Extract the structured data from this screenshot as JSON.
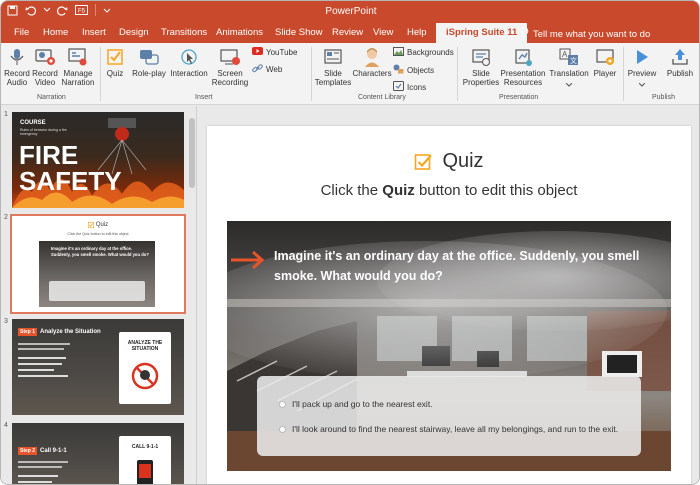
{
  "app": {
    "title": "PowerPoint"
  },
  "tabs": [
    {
      "label": "File"
    },
    {
      "label": "Home"
    },
    {
      "label": "Insert"
    },
    {
      "label": "Design"
    },
    {
      "label": "Transitions"
    },
    {
      "label": "Animations"
    },
    {
      "label": "Slide Show"
    },
    {
      "label": "Review"
    },
    {
      "label": "View"
    },
    {
      "label": "Help"
    },
    {
      "label": "iSpring Suite 11"
    }
  ],
  "tell_me": "Tell me what you want to do",
  "ribbon": {
    "narration": {
      "label": "Narration",
      "record_audio": "Record Audio",
      "record_video": "Record Video",
      "manage_narration": "Manage Narration"
    },
    "insert": {
      "label": "Insert",
      "quiz": "Quiz",
      "role_play": "Role-play",
      "interaction": "Interaction",
      "screen_recording": "Screen Recording",
      "youtube": "YouTube",
      "web": "Web"
    },
    "content_library": {
      "label": "Content Library",
      "slide_templates": "Slide Templates",
      "characters": "Characters",
      "backgrounds": "Backgrounds",
      "objects": "Objects",
      "icons": "Icons"
    },
    "presentation": {
      "label": "Presentation",
      "slide_properties": "Slide Properties",
      "presentation_resources": "Presentation Resources",
      "translation": "Translation",
      "player": "Player"
    },
    "publish": {
      "label": "Publish",
      "preview": "Preview",
      "publish": "Publish"
    }
  },
  "thumbnails": [
    {
      "number": "1",
      "course": "COURSE",
      "sub": "Rules of behavior during a fire emergency",
      "title_line1": "FIRE",
      "title_line2": "SAFETY"
    },
    {
      "number": "2",
      "title": "Quiz",
      "sub": "Click the Quiz button to edit this object",
      "question": "Imagine it's an ordinary day at the office. Suddenly, you smell smoke. What would you do?"
    },
    {
      "number": "3",
      "step": "Step 1",
      "heading": "Analyze the Situation",
      "card": "ANALYZE THE SITUATION"
    },
    {
      "number": "4",
      "step": "Step 2",
      "heading": "Call 9-1-1",
      "card": "CALL 9-1-1"
    }
  ],
  "slide": {
    "title": "Quiz",
    "instruction_prefix": "Click the ",
    "instruction_bold": "Quiz",
    "instruction_suffix": " button to edit this object",
    "question": "Imagine it's an ordinary day at the office. Suddenly, you smell smoke. What would you do?",
    "answers": [
      "I'll pack up and go to the nearest exit.",
      "I'll look around to find the nearest stairway, leave all my belongings, and run to the exit."
    ]
  },
  "colors": {
    "brand": "#c8492b",
    "accent_orange": "#e8542a",
    "check_orange": "#f5a623"
  }
}
